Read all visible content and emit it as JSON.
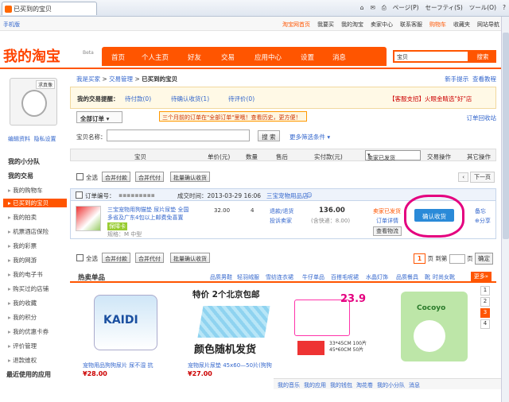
{
  "browser": {
    "tab_title": "已买到的宝贝",
    "tools": [
      "⌂",
      "✉",
      "⎙",
      "ページ(P)",
      "セーフティ(S)",
      "ツール(O)",
      "?"
    ]
  },
  "topbar": {
    "left": "手机版",
    "right": [
      "淘宝网首页",
      "我要买",
      "我的淘宝",
      "卖家中心",
      "联系客服",
      "购物车",
      "收藏夹",
      "网站导航"
    ]
  },
  "header": {
    "logo": "我的淘宝",
    "beta": "Beta",
    "nav": [
      "首页",
      "个人主页",
      "好友",
      "交易",
      "应用中心",
      "设置",
      "消息"
    ],
    "search_placeholder": "宝贝",
    "search_btn": "搜索"
  },
  "sidebar": {
    "avatar_tag": "求真像",
    "links": [
      "编辑资料",
      "隐私设置"
    ],
    "team": "我的小分队",
    "section1": "我的交易",
    "items": [
      "我的购物车",
      "已买到的宝贝",
      "我的拍卖",
      "机票酒店保险",
      "我的彩票",
      "我的网游",
      "我的电子书",
      "购买过的店铺",
      "我的收藏",
      "我的积分",
      "我的优惠卡券",
      "评价管理",
      "退款维权"
    ],
    "recent": "最近使用的应用"
  },
  "main": {
    "crumb": [
      "我是买家",
      "交易管理",
      "已买到的宝贝"
    ],
    "crumb_right": [
      "新手提示",
      "查看教程"
    ],
    "reminder_label": "我的交易提醒：",
    "reminder_items": [
      "待付款(0)",
      "待确认收货(1)",
      "待评价(0)"
    ],
    "reminder_right": "【客服支招】火眼金睛选\"好\"店",
    "order_dropdown": "全部订单",
    "notice": "三个月前的订单在\"全部订单\"里哦！查看历史，更方便！",
    "recycle": "订单回收站",
    "filter_label": "宝贝名称：",
    "filter_btn": "搜 索",
    "more_filters": "更多筛选条件",
    "columns": [
      "宝贝",
      "单价(元)",
      "数量",
      "售后",
      "实付款(元)",
      "交易操作",
      "其它操作"
    ],
    "status_select": "卖家已发货",
    "select_all": "全选",
    "batch_buttons": [
      "合并付款",
      "合并代付",
      "批量确认收货"
    ],
    "prev": "上一页",
    "next": "下一页",
    "order_no_label": "订单编号：",
    "order_time": "成交时间：2013-03-29 16:06",
    "shop": "三宝宠物用品店",
    "item_title1": "三宝宠物用狗猫垫 尿片尿垫 全国",
    "item_title2": "多省及广东4包以上邮费免喜置",
    "item_spec": "规格：M 中型",
    "item_badge": "保障卡",
    "price": "32.00",
    "qty": "4",
    "after1": "退款/退货",
    "after2": "投诉卖家",
    "total": "136.00",
    "shipping": "(含快递：8.00)",
    "status": "卖家已发货",
    "detail": "订单详情",
    "logistics": "查看物流",
    "confirm": "确认收货",
    "remark": "备忘",
    "share": "分享",
    "page_current": "1",
    "page_total": "页 到第",
    "page_unit": "页",
    "page_ok": "确定",
    "hot_title": "热卖单品",
    "hot_cats": [
      "品质男鞋",
      "轻羽绒服",
      "雪纺连衣裙",
      "牛仔单品",
      "百搭毛呢裙",
      "水晶灯饰",
      "品质餐具",
      "靴",
      "时尚女靴"
    ],
    "more": "更多»",
    "products": [
      {
        "name": "宠物用品狗狗尿片 尿不湿 抗",
        "price": "¥28.00",
        "brand": "KAIDI"
      },
      {
        "name": "宠物尿片尿垫 45x60—50片(狗狗",
        "price": "¥27.00",
        "promo1": "特价 2个北京包邮",
        "promo2": "颜色随机发货"
      },
      {
        "name": "",
        "price": "",
        "tag1": "23.9",
        "tag2": "33*45CM 100片",
        "tag3": "45*60CM 50片"
      },
      {
        "name": "",
        "price": "",
        "brand": "Cocoyo"
      }
    ],
    "rnav": [
      "1",
      "2",
      "3",
      "4"
    ]
  },
  "bottombar": [
    "我的音乐",
    "我的应用",
    "我的钱包",
    "淘花卷",
    "我的小分队",
    "消息"
  ]
}
